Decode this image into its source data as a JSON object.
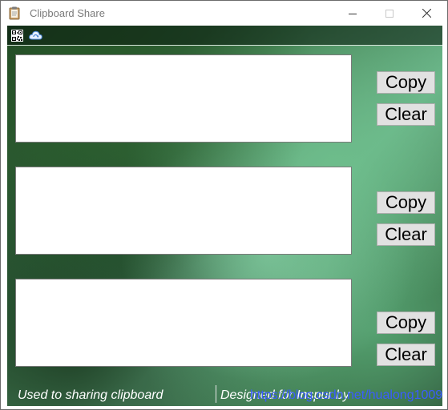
{
  "window": {
    "title": "Clipboard Share",
    "controls": [
      "minimize",
      "maximize",
      "close"
    ]
  },
  "toolbar": {
    "icons": [
      "qr-code-icon",
      "cloud-icon"
    ]
  },
  "slots": [
    {
      "text": "",
      "copy_label": "Copy",
      "clear_label": "Clear"
    },
    {
      "text": "",
      "copy_label": "Copy",
      "clear_label": "Clear"
    },
    {
      "text": "",
      "copy_label": "Copy",
      "clear_label": "Clear"
    }
  ],
  "status": {
    "left_text": "Used to sharing clipboard",
    "right_text": "Designed for Inspur by",
    "link_text": "https://blog.csdn.net/hualong1009",
    "link_color": "#3a5cff"
  },
  "colors": {
    "title_text": "#7a7a7a",
    "button_bg": "#e1e1e1",
    "status_text": "#ffffff"
  }
}
